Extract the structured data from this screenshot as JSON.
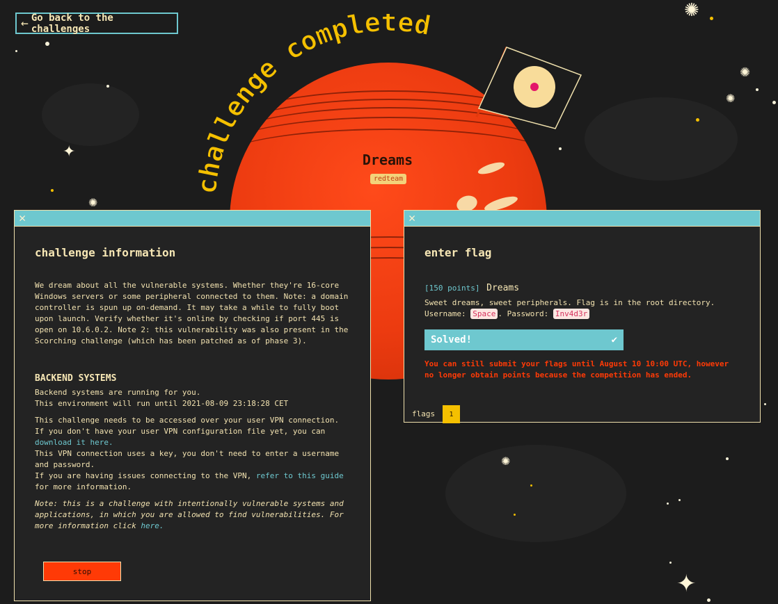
{
  "header": {
    "back_label": "Go back to the challenges",
    "banner": "challenge completed"
  },
  "challenge": {
    "name": "Dreams",
    "tag": "redteam"
  },
  "info_panel": {
    "title": "challenge information",
    "description": "We dream about all the vulnerable systems. Whether they're 16-core Windows servers or some peripheral connected to them. Note: a domain controller is spun up on-demand. It may take a while to fully boot upon launch. Verify whether it's online by checking if port 445 is open on 10.6.0.2. Note 2: this vulnerability was also present in the Scorching challenge (which has been patched as of phase 3).",
    "backend_title": "BACKEND SYSTEMS",
    "backend_running": "Backend systems are running for you.",
    "backend_until": "This environment will run until 2021-08-09 23:18:28 CET",
    "vpn_line1": "This challenge needs to be accessed over your user VPN connection.",
    "vpn_line2": "If you don't have your user VPN configuration file yet, you can",
    "vpn_download_link": "download it here.",
    "vpn_line3": "This VPN connection uses a key, you don't need to enter a username and password.",
    "vpn_line4": "If you are having issues connecting to the VPN,",
    "vpn_guide_link": "refer to this guide",
    "vpn_line5": "for more information.",
    "note_text": "Note: this is a challenge with intentionally vulnerable systems and applications, in which you are allowed to find vulnerabilities. For more information click",
    "note_link": "here.",
    "stop_label": "stop"
  },
  "flag_panel": {
    "title": "enter flag",
    "points": "[150 points]",
    "challenge_name": "Dreams",
    "desc_line1": "Sweet dreams, sweet peripherals. Flag is in the root directory.",
    "username_label": "Username:",
    "username": "Space",
    "password_label": ". Password:",
    "password": "Inv4d3r",
    "solved_label": "Solved!",
    "warning": "You can still submit your flags until August 10 10:00 UTC, however no longer obtain points because the competition has ended.",
    "flags_label": "flags",
    "flags_count": "1"
  },
  "colors": {
    "accent": "#6ec8cf",
    "danger": "#ff3a06",
    "gold": "#f5c000",
    "text": "#f2e2b0"
  }
}
